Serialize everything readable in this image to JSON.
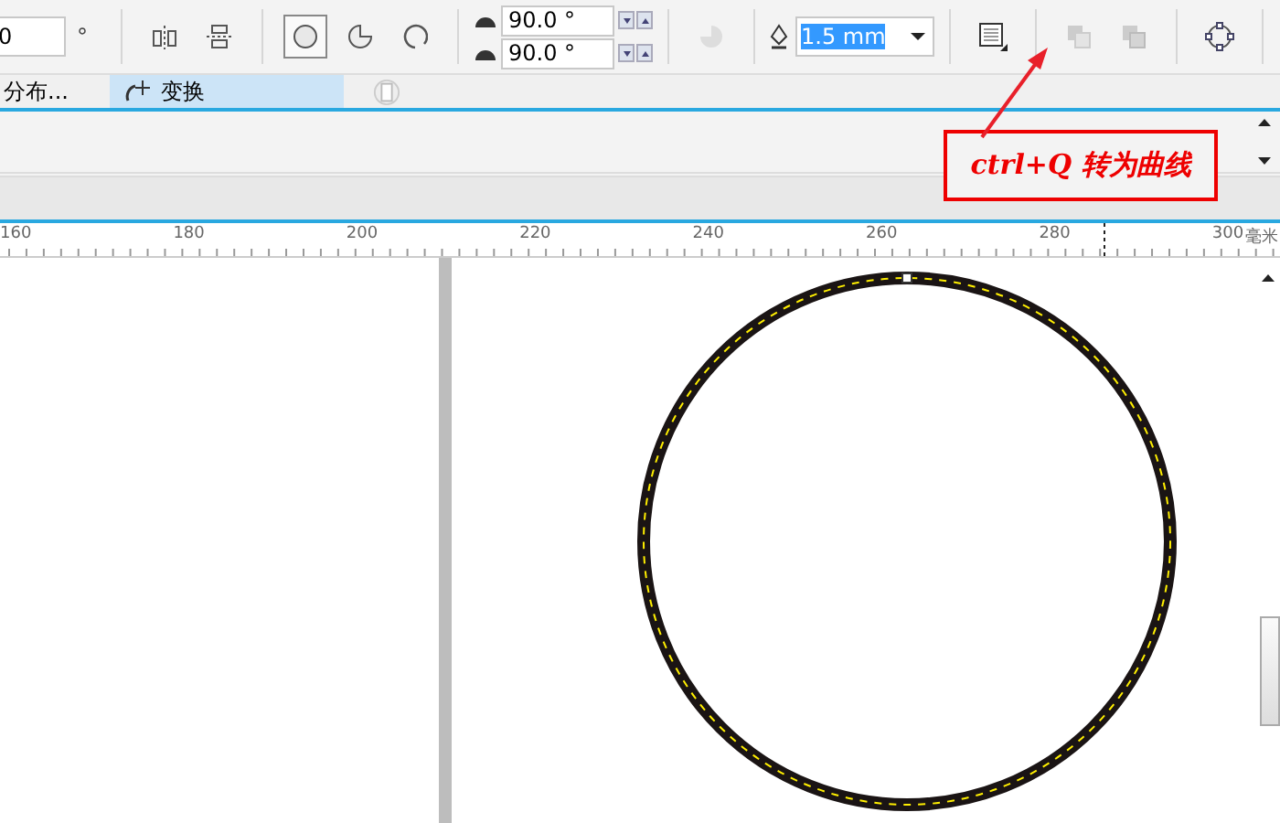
{
  "toolbar": {
    "angle_value": "0",
    "angle_unit": "°",
    "arc_shapes": [
      {
        "kind": "ellipse",
        "selected": true
      },
      {
        "kind": "pie",
        "selected": false
      },
      {
        "kind": "arc",
        "selected": false
      }
    ],
    "start_angle": "90.0 °",
    "end_angle": "90.0 °",
    "outline_width": "1.5 mm"
  },
  "docker_tabs": [
    {
      "label": "分布...",
      "selected": false
    },
    {
      "label": "变换",
      "selected": true
    }
  ],
  "annotation": {
    "text": "ctrl+Q 转为曲线"
  },
  "ruler": {
    "labels": [
      "160",
      "180",
      "200",
      "220",
      "240",
      "260",
      "280",
      "300"
    ],
    "unit": "毫米"
  }
}
